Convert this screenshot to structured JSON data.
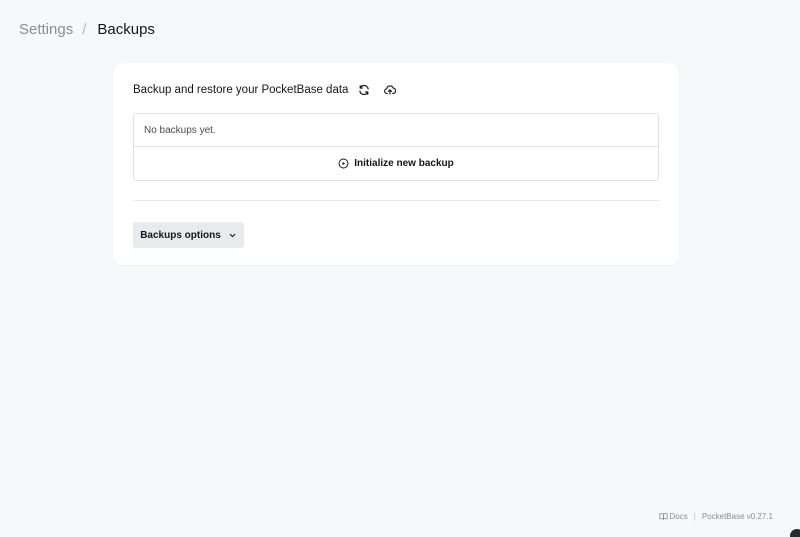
{
  "breadcrumb": {
    "parent": "Settings",
    "separator": "/",
    "current": "Backups"
  },
  "card": {
    "title": "Backup and restore your PocketBase data",
    "refresh_icon": "refresh-icon",
    "upload_icon": "cloud-upload-icon",
    "empty_text": "No backups yet.",
    "init_label": "Initialize new backup",
    "init_icon": "play-circle-icon",
    "options_label": "Backups options",
    "options_icon": "chevron-down-icon"
  },
  "footer": {
    "docs_label": "Docs",
    "docs_icon": "book-icon",
    "separator": "|",
    "version": "PocketBase v0.27.1"
  },
  "colors": {
    "page_bg": "#f7f8fa",
    "card_bg": "#ffffff",
    "border": "#dfe1e5",
    "muted_text": "#8a8d93",
    "button_bg": "#e9eaee"
  }
}
